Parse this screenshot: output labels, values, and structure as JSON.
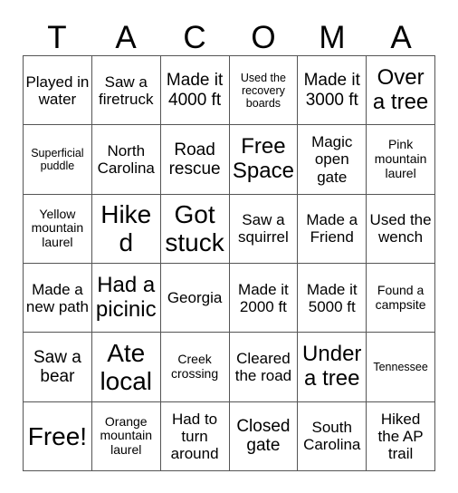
{
  "card": {
    "title_letters": [
      "T",
      "A",
      "C",
      "O",
      "M",
      "A"
    ],
    "colors": {
      "background": "#ffffff",
      "text": "#000000",
      "border": "#555555"
    },
    "grid": {
      "columns": 6,
      "rows": 6,
      "cells": [
        {
          "text": "Played in water",
          "size": "md"
        },
        {
          "text": "Saw a firetruck",
          "size": "md"
        },
        {
          "text": "Made it 4000 ft",
          "size": "lg"
        },
        {
          "text": "Used the recovery boards",
          "size": "xs"
        },
        {
          "text": "Made it 3000 ft",
          "size": "lg"
        },
        {
          "text": "Over a tree",
          "size": "xl"
        },
        {
          "text": "Superficial puddle",
          "size": "xs"
        },
        {
          "text": "North Carolina",
          "size": "md"
        },
        {
          "text": "Road rescue",
          "size": "lg"
        },
        {
          "text": "Free Space",
          "size": "xl"
        },
        {
          "text": "Magic open gate",
          "size": "md"
        },
        {
          "text": "Pink mountain laurel",
          "size": "sm"
        },
        {
          "text": "Yellow mountain laurel",
          "size": "sm"
        },
        {
          "text": "Hiked",
          "size": "xxl"
        },
        {
          "text": "Got stuck",
          "size": "xxl"
        },
        {
          "text": "Saw a squirrel",
          "size": "md"
        },
        {
          "text": "Made a Friend",
          "size": "md"
        },
        {
          "text": "Used the wench",
          "size": "md"
        },
        {
          "text": "Made a new path",
          "size": "md"
        },
        {
          "text": "Had a picinic",
          "size": "xl"
        },
        {
          "text": "Georgia",
          "size": "md"
        },
        {
          "text": "Made it 2000 ft",
          "size": "md"
        },
        {
          "text": "Made it 5000 ft",
          "size": "md"
        },
        {
          "text": "Found a campsite",
          "size": "sm"
        },
        {
          "text": "Saw a bear",
          "size": "lg"
        },
        {
          "text": "Ate local",
          "size": "xxl"
        },
        {
          "text": "Creek crossing",
          "size": "sm"
        },
        {
          "text": "Cleared the road",
          "size": "md"
        },
        {
          "text": "Under a tree",
          "size": "xl"
        },
        {
          "text": "Tennessee",
          "size": "xs"
        },
        {
          "text": "Free!",
          "size": "xxl"
        },
        {
          "text": "Orange mountain laurel",
          "size": "sm"
        },
        {
          "text": "Had to turn around",
          "size": "md"
        },
        {
          "text": "Closed gate",
          "size": "lg"
        },
        {
          "text": "South Carolina",
          "size": "md"
        },
        {
          "text": "Hiked the AP trail",
          "size": "md"
        }
      ]
    }
  }
}
